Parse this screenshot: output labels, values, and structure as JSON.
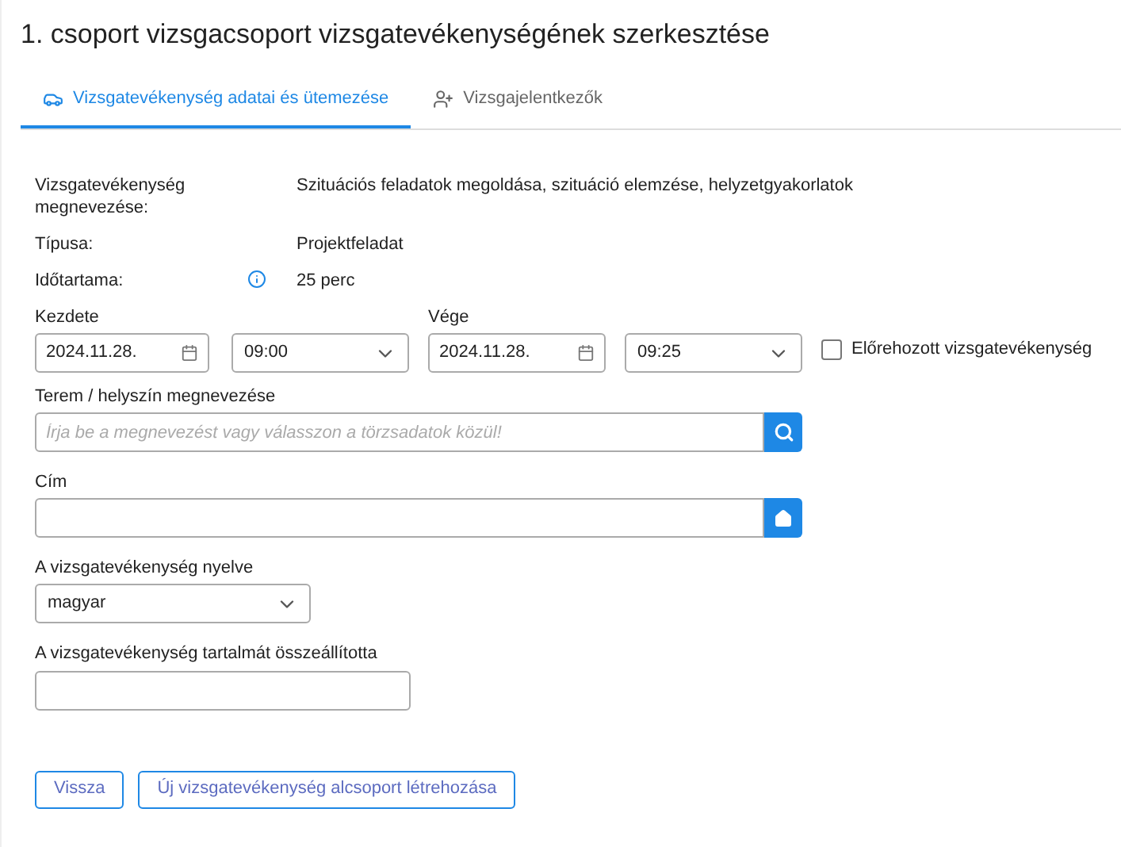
{
  "title": "1. csoport vizsgacsoport vizsgatevékenységének szerkesztése",
  "tabs": [
    {
      "label": "Vizsgatevékenység adatai és ütemezése",
      "selected": true,
      "kind": "car"
    },
    {
      "label": "Vizsgajelentkezők",
      "selected": false,
      "kind": "person"
    }
  ],
  "info": [
    {
      "label": "Vizsgatevékenység megnevezése:",
      "value": "Szituációs feladatok megoldása, szituáció elemzése, helyzetgyakorlatok",
      "info_icon": false
    },
    {
      "label": "Típusa:",
      "value": "Projektfeladat",
      "info_icon": false
    },
    {
      "label": "Időtartama:",
      "value": "25 perc",
      "info_icon": true
    }
  ],
  "start": {
    "label": "Kezdete",
    "date": "2024.11.28.",
    "time": "09:00"
  },
  "end": {
    "label": "Vége",
    "date": "2024.11.28.",
    "time": "09:25"
  },
  "early": {
    "label": "Előrehozott vizsgatevékenység",
    "checked": false
  },
  "location": {
    "label": "Terem / helyszín megnevezése",
    "placeholder": "Írja be a megnevezést vagy válasszon a törzsadatok közül!"
  },
  "address": {
    "label": "Cím"
  },
  "language": {
    "label": "A vizsgatevékenység nyelve",
    "value": "magyar"
  },
  "composer": {
    "label": "A vizsgatevékenység tartalmát összeállította"
  },
  "buttons": [
    "Vissza",
    "Új vizsgatevékenység alcsoport létrehozása"
  ]
}
